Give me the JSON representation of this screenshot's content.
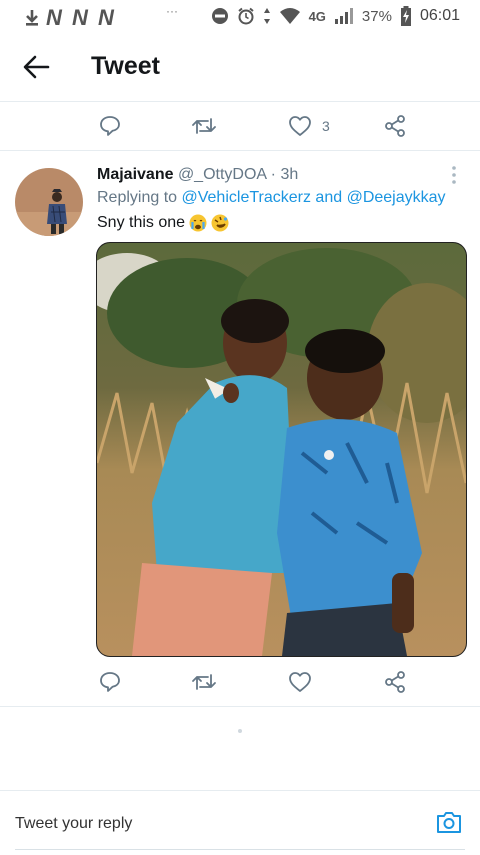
{
  "status_bar": {
    "carrier_glyphs": "N N N",
    "overflow_dots": "···",
    "network": "4G",
    "battery": "37%",
    "time": "06:01"
  },
  "header": {
    "title": "Tweet"
  },
  "top_actions": {
    "like_count": "3"
  },
  "tweet": {
    "author": "Majaivane",
    "handle": "@_OttyDOA",
    "separator": "·",
    "time": "3h",
    "replying_prefix": "Replying to",
    "reply_mention_1": "@VehicleTrackerz",
    "reply_and": "and",
    "reply_mention_2": "@Deejaykkay",
    "text": "Sny this one"
  },
  "reply_box": {
    "placeholder": "Tweet your reply"
  },
  "colors": {
    "accent": "#1b95e0",
    "icon_gray": "#657786",
    "divider": "#e6ecf0"
  }
}
